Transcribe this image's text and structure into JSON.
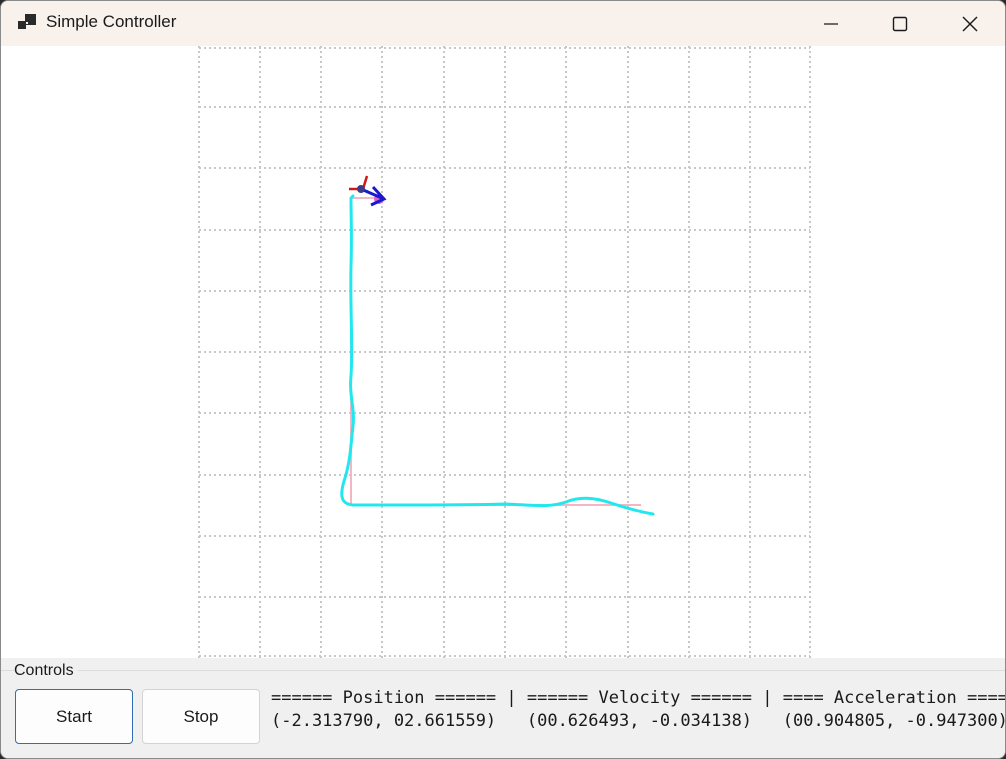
{
  "window": {
    "title": "Simple Controller",
    "icons": {
      "app": "app-icon",
      "minimize": "minimize-icon",
      "maximize": "maximize-icon",
      "close": "close-icon"
    }
  },
  "canvas": {
    "grid_color": "#c8c8c8",
    "path_color": "#22e8ee",
    "target_path_color": "#f4b6c4",
    "robot": {
      "x_axis_color": "#1a1acc",
      "y_axis_color": "#cc1a1a",
      "body_color": "#3b3b8a",
      "marker_color": "#e060d0"
    }
  },
  "controls": {
    "label": "Controls",
    "start_label": "Start",
    "stop_label": "Stop",
    "readout_header": "====== Position ====== | ====== Velocity ====== | ==== Acceleration ====",
    "readout_values": "(-2.313790, 02.661559)   (00.626493, -0.034138)   (00.904805, -0.947300)",
    "position": {
      "x": -2.31379,
      "y": 2.661559
    },
    "velocity": {
      "x": 0.626493,
      "y": -0.034138
    },
    "acceleration": {
      "x": 0.904805,
      "y": -0.9473
    }
  }
}
